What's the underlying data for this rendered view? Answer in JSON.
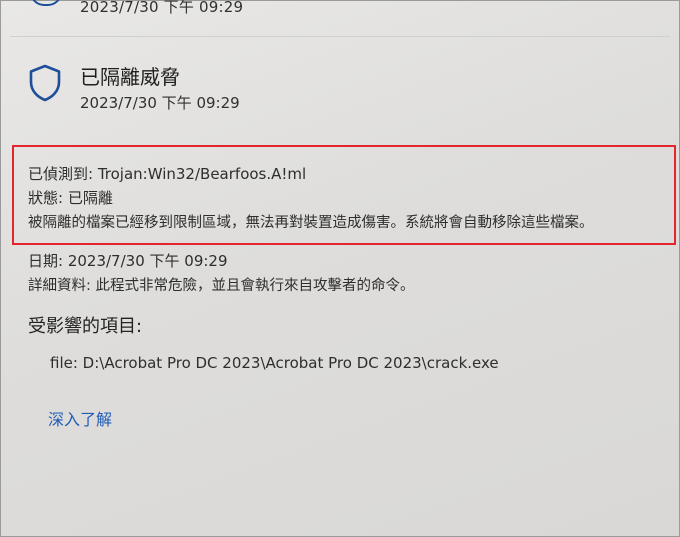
{
  "previous_item": {
    "timestamp": "2023/7/30 下午 09:29"
  },
  "threat": {
    "icon": "shield-icon",
    "title": "已隔離威脅",
    "timestamp": "2023/7/30 下午 09:29"
  },
  "details": {
    "detected": "已偵測到: Trojan:Win32/Bearfoos.A!ml",
    "status": "狀態: 已隔離",
    "description": "被隔離的檔案已經移到限制區域，無法再對裝置造成傷害。系統將會自動移除這些檔案。",
    "date": "日期: 2023/7/30 下午 09:29",
    "info": "詳細資料: 此程式非常危險，並且會執行來自攻擊者的命令。"
  },
  "affected": {
    "heading": "受影響的項目:",
    "file": "file: D:\\Acrobat Pro DC 2023\\Acrobat Pro DC 2023\\crack.exe"
  },
  "learn_more_label": "深入了解",
  "colors": {
    "highlight_border": "#e4252b",
    "shield": "#1e4f9a",
    "link": "#1f5cb8"
  }
}
